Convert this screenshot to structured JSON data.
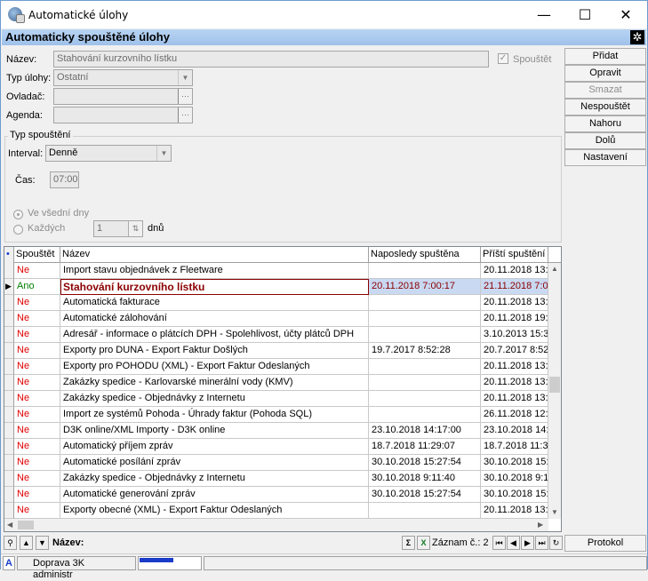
{
  "window": {
    "title": "Automatické úlohy",
    "minimize": "—",
    "maximize": "☐",
    "close": "✕"
  },
  "header": {
    "title": "Automaticky spouštěné úlohy"
  },
  "form": {
    "name_label": "Název:",
    "name_value": "Stahování kurzovního lístku",
    "type_label": "Typ úlohy:",
    "type_value": "Ostatní",
    "driver_label": "Ovladač:",
    "agenda_label": "Agenda:",
    "run_checkbox_label": "Spouštět",
    "run_checked": true
  },
  "schedule": {
    "group_title": "Typ spouštění",
    "interval_label": "Interval:",
    "interval_value": "Denně",
    "time_label": "Čas:",
    "time_value": "07:00",
    "weekdays_label": "Ve všední dny",
    "every_label": "Každých",
    "every_value": "1",
    "days_label": "dnů"
  },
  "side_buttons": [
    {
      "label": "Přidat",
      "enabled": true
    },
    {
      "label": "Opravit",
      "enabled": true
    },
    {
      "label": "Smazat",
      "enabled": false
    },
    {
      "label": "Nespouštět",
      "enabled": true
    },
    {
      "label": "Nahoru",
      "enabled": true
    },
    {
      "label": "Dolů",
      "enabled": true
    },
    {
      "label": "Nastavení",
      "enabled": true
    }
  ],
  "table": {
    "columns": [
      "Spouštět",
      "Název",
      "Naposledy spuštěna",
      "Příští spuštění"
    ],
    "rows": [
      {
        "run": "Ne",
        "name": "Import stavu objednávek z Fleetware",
        "last": "",
        "next": "20.11.2018 13:"
      },
      {
        "run": "Ano",
        "name": "Stahování kurzovního lístku",
        "last": "20.11.2018 7:00:17",
        "next": "21.11.2018 7:0",
        "selected": true
      },
      {
        "run": "Ne",
        "name": "Automatická fakturace",
        "last": "",
        "next": "20.11.2018 13:"
      },
      {
        "run": "Ne",
        "name": "Automatické zálohování",
        "last": "",
        "next": "20.11.2018 19:"
      },
      {
        "run": "Ne",
        "name": "Adresář - informace o plátcích DPH - Spolehlivost, účty plátců DPH",
        "last": "",
        "next": "3.10.2013 15:3"
      },
      {
        "run": "Ne",
        "name": "Exporty pro DUNA - Export Faktur Došlých",
        "last": "19.7.2017 8:52:28",
        "next": "20.7.2017 8:52"
      },
      {
        "run": "Ne",
        "name": "Exporty pro POHODU (XML) - Export Faktur Odeslaných",
        "last": "",
        "next": "20.11.2018 13:"
      },
      {
        "run": "Ne",
        "name": "Zakázky spedice - Karlovarské minerální vody (KMV)",
        "last": "",
        "next": "20.11.2018 13:"
      },
      {
        "run": "Ne",
        "name": "Zakázky spedice - Objednávky z Internetu",
        "last": "",
        "next": "20.11.2018 13:"
      },
      {
        "run": "Ne",
        "name": "Import ze systémů Pohoda - Úhrady faktur (Pohoda SQL)",
        "last": "",
        "next": "26.11.2018 12:"
      },
      {
        "run": "Ne",
        "name": "D3K online/XML Importy - D3K online",
        "last": "23.10.2018 14:17:00",
        "next": "23.10.2018 14:"
      },
      {
        "run": "Ne",
        "name": "Automatický příjem zpráv",
        "last": "18.7.2018 11:29:07",
        "next": "18.7.2018 11:3"
      },
      {
        "run": "Ne",
        "name": "Automatické posílání zpráv",
        "last": "30.10.2018 15:27:54",
        "next": "30.10.2018 15:"
      },
      {
        "run": "Ne",
        "name": "Zakázky spedice - Objednávky z Internetu",
        "last": "30.10.2018 9:11:40",
        "next": "30.10.2018 9:1"
      },
      {
        "run": "Ne",
        "name": "Automatické generování zpráv",
        "last": "30.10.2018 15:27:54",
        "next": "30.10.2018 15:"
      },
      {
        "run": "Ne",
        "name": "Exporty obecné (XML) - Export Faktur Odeslaných",
        "last": "",
        "next": "20.11.2018 13:"
      }
    ]
  },
  "navbar": {
    "filter_label": "Název:",
    "record_label": "Záznam č.: 2",
    "protocol_button": "Protokol"
  },
  "status": {
    "indicator": "A",
    "user": "Doprava 3K administr"
  },
  "colors": {
    "accent": "#9fc1ea",
    "no": "#e00000",
    "yes": "#008000",
    "selected_text": "#8b0000"
  }
}
